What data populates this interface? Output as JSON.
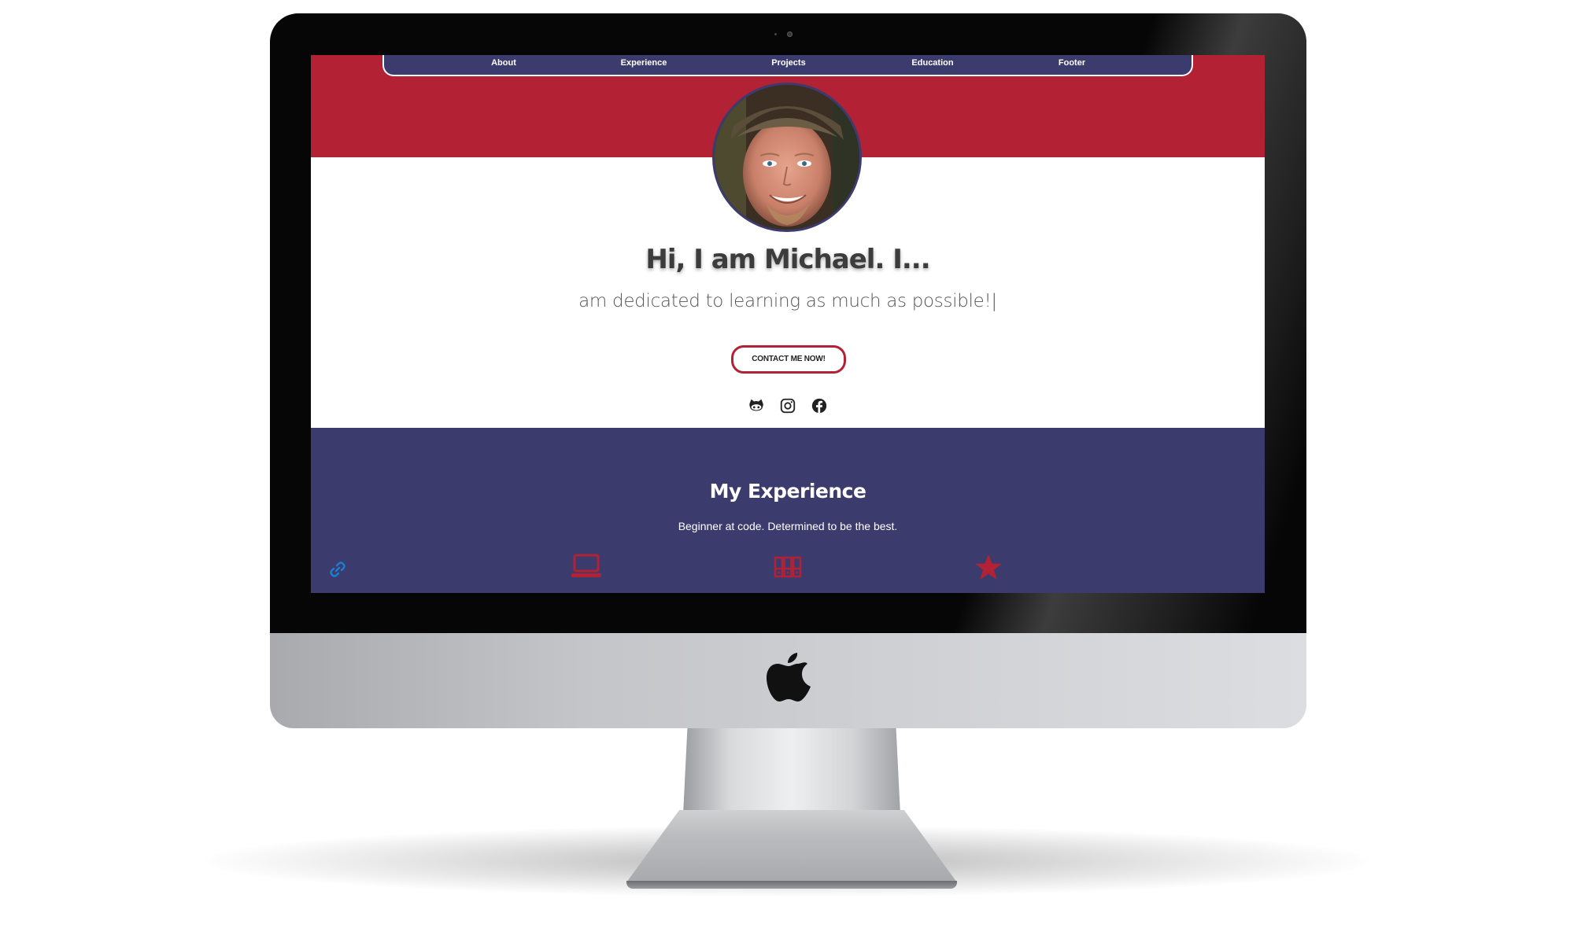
{
  "nav": {
    "items": [
      {
        "label": "About"
      },
      {
        "label": "Experience"
      },
      {
        "label": "Projects"
      },
      {
        "label": "Education"
      },
      {
        "label": "Footer"
      }
    ]
  },
  "hero": {
    "title": "Hi, I am Michael. I...",
    "subtitle": "am dedicated to learning as much as possible!",
    "cursor": "|",
    "contact_label": "CONTACT ME NOW!"
  },
  "socials": [
    "github-icon",
    "instagram-icon",
    "facebook-icon"
  ],
  "experience": {
    "title": "My Experience",
    "subtitle": "Beginner at code. Determined to be the best.",
    "icons": [
      "link-icon",
      "laptop-icon",
      "server-icon",
      "star-icon"
    ]
  },
  "colors": {
    "red": "#b22234",
    "navy": "#3c3b6e",
    "white": "#ffffff",
    "link_blue": "#1a7fd4"
  }
}
